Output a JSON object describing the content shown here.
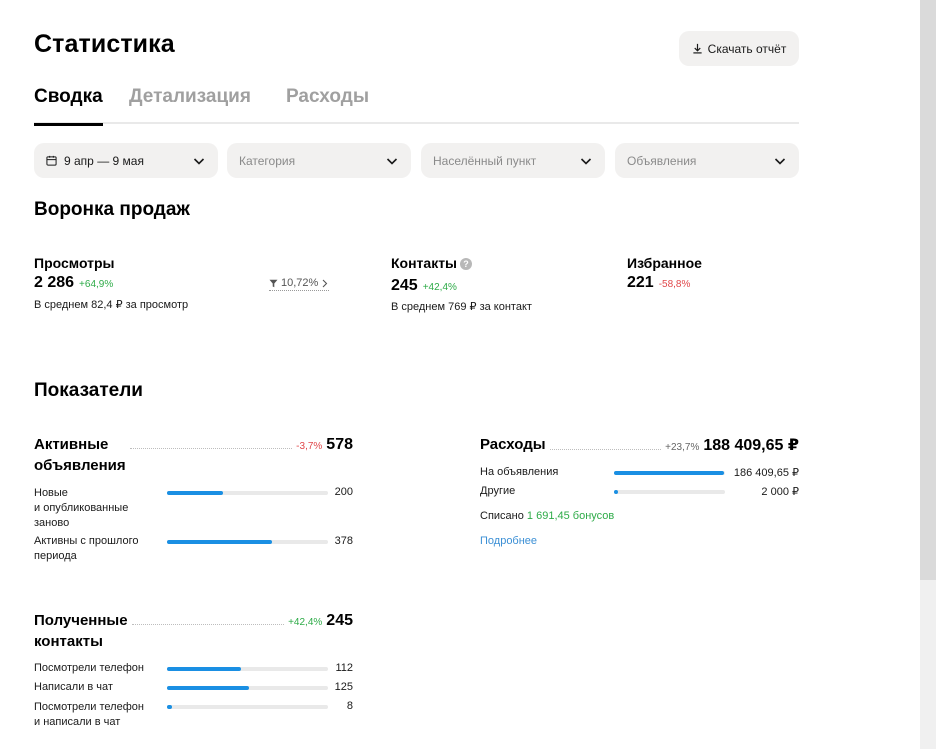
{
  "header": {
    "title": "Статистика",
    "download_label": "Скачать отчёт"
  },
  "tabs": [
    {
      "label": "Сводка",
      "active": true
    },
    {
      "label": "Детализация"
    },
    {
      "label": "Расходы"
    }
  ],
  "filters": {
    "date": "9 апр — 9 мая",
    "category": "Категория",
    "city": "Населённый пункт",
    "ads": "Объявления"
  },
  "funnel": {
    "title": "Воронка продаж",
    "views": {
      "label": "Просмотры",
      "value": "2 286",
      "delta": "+64,9%",
      "sub": "В среднем 82,4 ₽ за просмотр"
    },
    "conversion": "10,72%",
    "contacts": {
      "label": "Контакты",
      "value": "245",
      "delta": "+42,4%",
      "sub": "В среднем 769 ₽ за контакт",
      "help": "?"
    },
    "favorites": {
      "label": "Избранное",
      "value": "221",
      "delta": "-58,8%"
    }
  },
  "indicators": {
    "title": "Показатели",
    "active_ads": {
      "title_line1": "Активные",
      "title_line2": "объявления",
      "delta": "-3,7%",
      "total": "578",
      "rows": [
        {
          "label_lines": [
            "Новые",
            "и опубликованные",
            "заново"
          ],
          "value": "200",
          "fraction": 0.346
        },
        {
          "label_lines": [
            "Активны с прошлого",
            "периода"
          ],
          "value": "378",
          "fraction": 0.654
        }
      ]
    },
    "expenses": {
      "title": "Расходы",
      "delta": "+23,7%",
      "total": "188 409,65 ₽",
      "rows": [
        {
          "label": "На объявления",
          "value": "186 409,65 ₽",
          "fraction": 0.989
        },
        {
          "label": "Другие",
          "value": "2 000 ₽",
          "fraction": 0.04
        }
      ],
      "spent_prefix": "Списано",
      "spent_bonus": "1 691,45 бонусов",
      "more_link": "Подробнее"
    },
    "received_contacts": {
      "title_line1": "Полученные",
      "title_line2": "контакты",
      "delta": "+42,4%",
      "total": "245",
      "rows": [
        {
          "label_lines": [
            "Посмотрели телефон"
          ],
          "value": "112",
          "fraction": 0.457
        },
        {
          "label_lines": [
            "Написали в чат"
          ],
          "value": "125",
          "fraction": 0.51
        },
        {
          "label_lines": [
            "Посмотрели телефон",
            "и написали в чат"
          ],
          "value": "8",
          "fraction": 0.033
        }
      ]
    }
  },
  "colors": {
    "accent_bar": "#1a8fe3",
    "positive": "#2eab48",
    "negative": "#e0484b",
    "link": "#3b8fd5"
  }
}
